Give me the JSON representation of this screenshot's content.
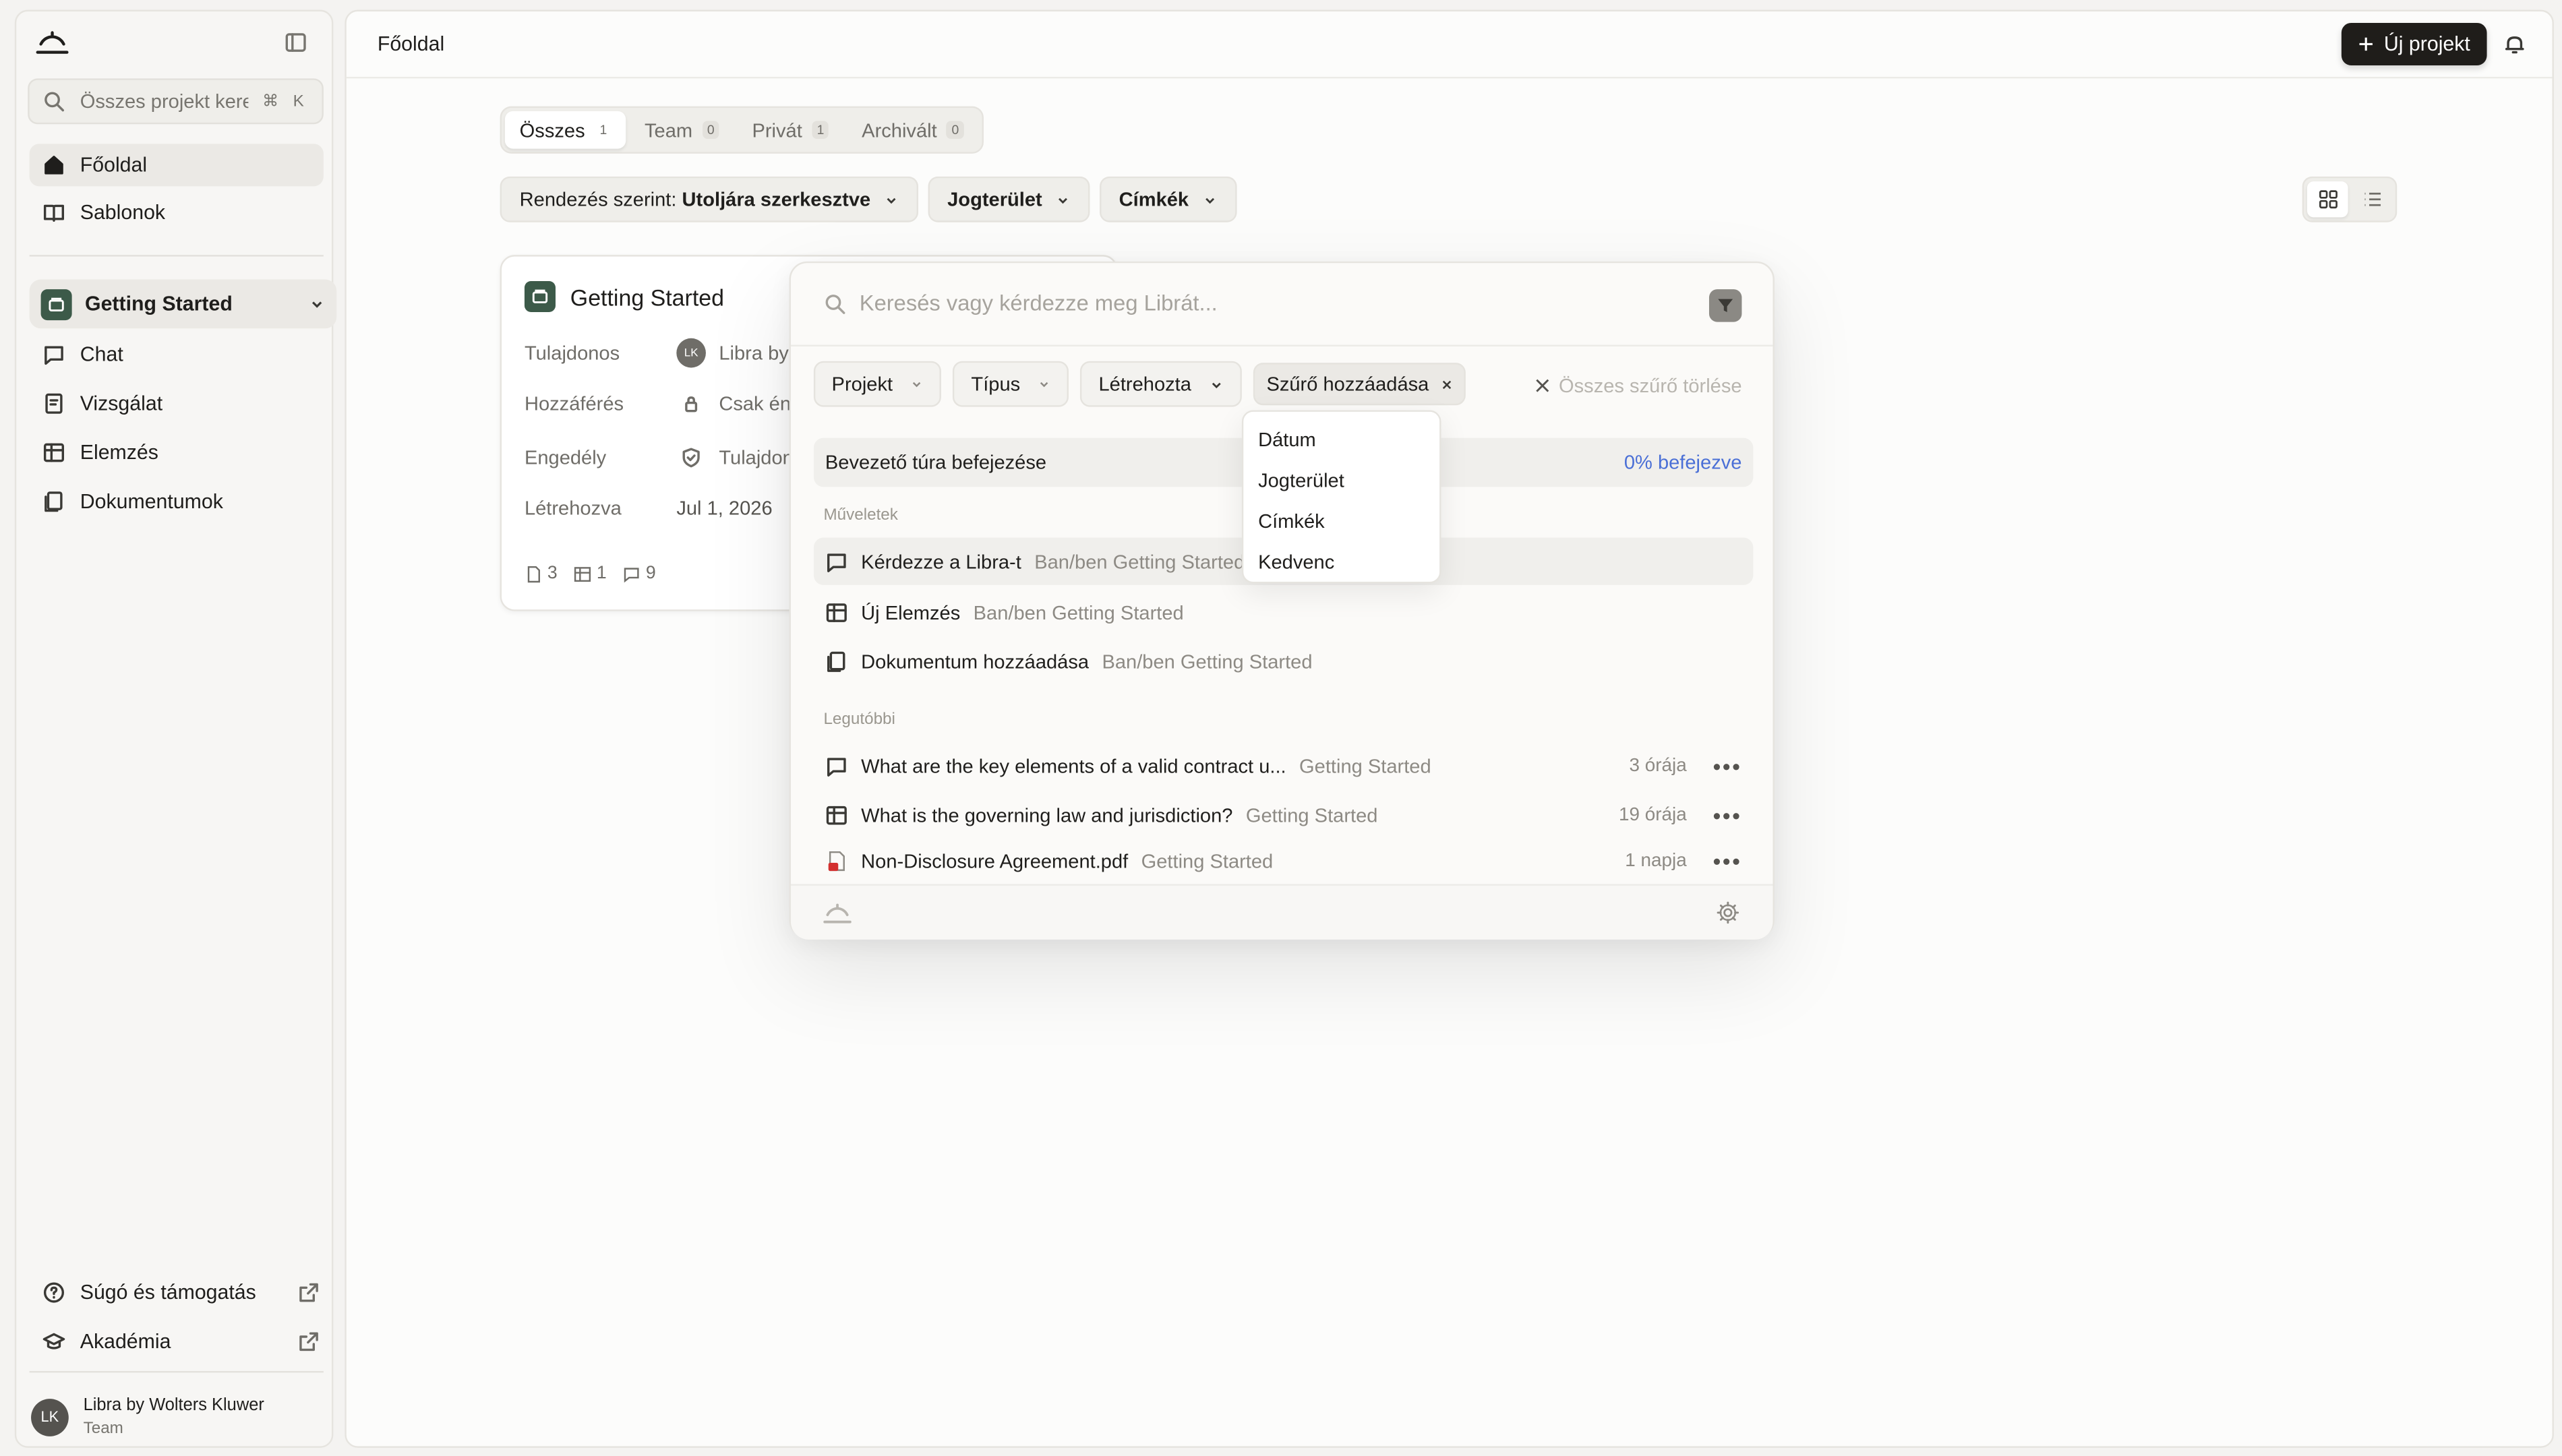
{
  "sidebar": {
    "search_placeholder": "Összes projekt kere...",
    "search_shortcut": "⌘ K",
    "nav": [
      {
        "label": "Főoldal",
        "icon": "home-icon"
      },
      {
        "label": "Sablonok",
        "icon": "book-icon"
      }
    ],
    "project": {
      "label": "Getting Started"
    },
    "project_items": [
      {
        "label": "Chat",
        "icon": "chat-icon"
      },
      {
        "label": "Vizsgálat",
        "icon": "review-icon"
      },
      {
        "label": "Elemzés",
        "icon": "table-icon"
      },
      {
        "label": "Dokumentumok",
        "icon": "documents-icon"
      }
    ],
    "footer_items": [
      {
        "label": "Súgó és támogatás",
        "icon": "help-icon"
      },
      {
        "label": "Akadémia",
        "icon": "academy-icon"
      }
    ],
    "user": {
      "initials": "LK",
      "name": "Libra by Wolters Kluwer",
      "team": "Team"
    }
  },
  "header": {
    "title": "Főoldal",
    "new_project": "Új projekt"
  },
  "tabs": [
    {
      "label": "Összes",
      "count": "1"
    },
    {
      "label": "Team",
      "count": "0"
    },
    {
      "label": "Privát",
      "count": "1"
    },
    {
      "label": "Archivált",
      "count": "0"
    }
  ],
  "filters": {
    "sort_prefix": "Rendezés szerint:",
    "sort_value": "Utoljára szerkesztve",
    "jurisdiction": "Jogterület",
    "tags": "Címkék"
  },
  "card": {
    "title": "Getting Started",
    "rows": [
      {
        "key": "Tulajdonos",
        "value": "Libra by"
      },
      {
        "key": "Hozzáférés",
        "value": "Csak én"
      },
      {
        "key": "Engedély",
        "value": "Tulajdon"
      },
      {
        "key": "Létrehozva",
        "value": "Jul 1, 2026"
      }
    ],
    "owner_initials": "LK",
    "stats": {
      "docs": "3",
      "tables": "1",
      "chats": "9"
    }
  },
  "palette": {
    "search_placeholder": "Keresés vagy kérdezze meg Librát...",
    "chips": [
      "Projekt",
      "Típus",
      "Létrehozta"
    ],
    "add_filter": "Szűrő hozzáadása",
    "clear_all": "Összes szűrő törlése",
    "tour": {
      "label": "Bevezető túra befejezése",
      "progress": "0% befejezve"
    },
    "actions_label": "Műveletek",
    "actions": [
      {
        "label": "Kérdezze a Libra-t",
        "context": "Ban/ben Getting Started",
        "icon": "chat-icon"
      },
      {
        "label": "Új Elemzés",
        "context": "Ban/ben Getting Started",
        "icon": "table-icon"
      },
      {
        "label": "Dokumentum hozzáadása",
        "context": "Ban/ben Getting Started",
        "icon": "documents-icon"
      }
    ],
    "recent_label": "Legutóbbi",
    "recent": [
      {
        "label": "What are the key elements of a valid contract u...",
        "context": "Getting Started",
        "time": "3 órája",
        "icon": "chat-icon"
      },
      {
        "label": "What is the governing law and jurisdiction?",
        "context": "Getting Started",
        "time": "19 órája",
        "icon": "table-icon"
      },
      {
        "label": "Non-Disclosure Agreement.pdf",
        "context": "Getting Started",
        "time": "1 napja",
        "icon": "pdf-icon"
      }
    ]
  },
  "dropdown": [
    "Dátum",
    "Jogterület",
    "Címkék",
    "Kedvenc"
  ],
  "colors": {
    "accent_dark": "#1f1d1a",
    "project_green": "#3c5a49",
    "progress_blue": "#4a6fd6"
  }
}
